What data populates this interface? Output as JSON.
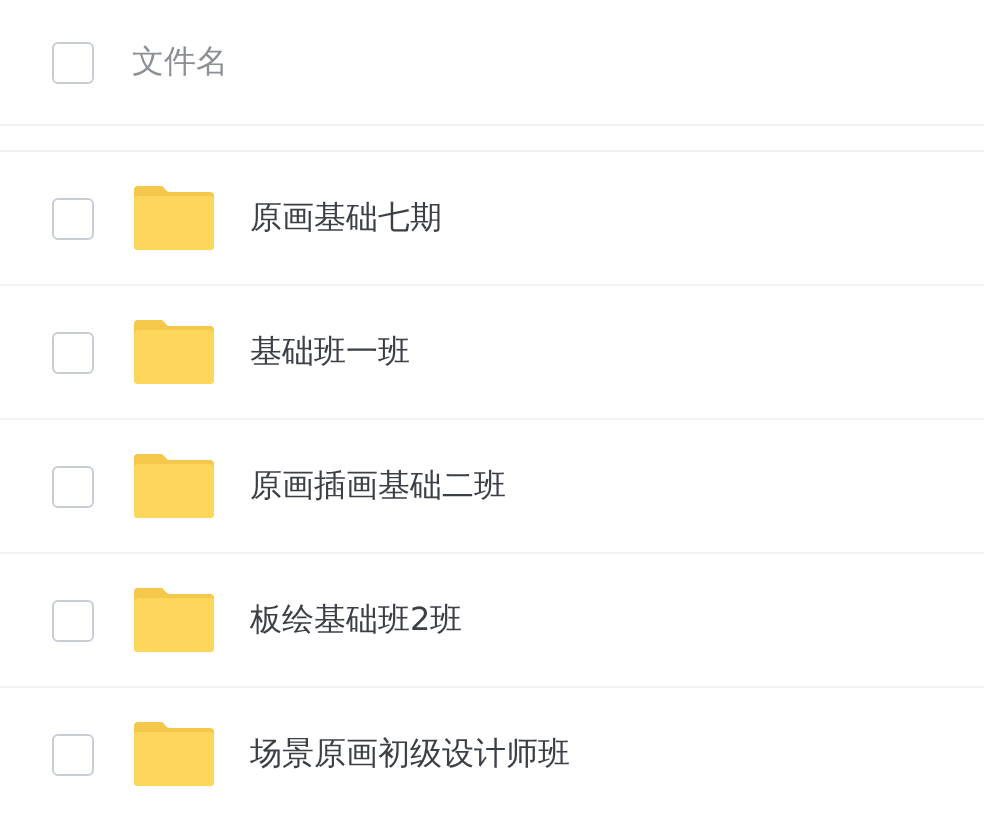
{
  "header": {
    "checked": false,
    "label": "文件名"
  },
  "files": [
    {
      "name": "原画基础七期",
      "checked": false
    },
    {
      "name": "基础班一班",
      "checked": false
    },
    {
      "name": "原画插画基础二班",
      "checked": false
    },
    {
      "name": "板绘基础班2班",
      "checked": false
    },
    {
      "name": "场景原画初级设计师班",
      "checked": false
    }
  ]
}
